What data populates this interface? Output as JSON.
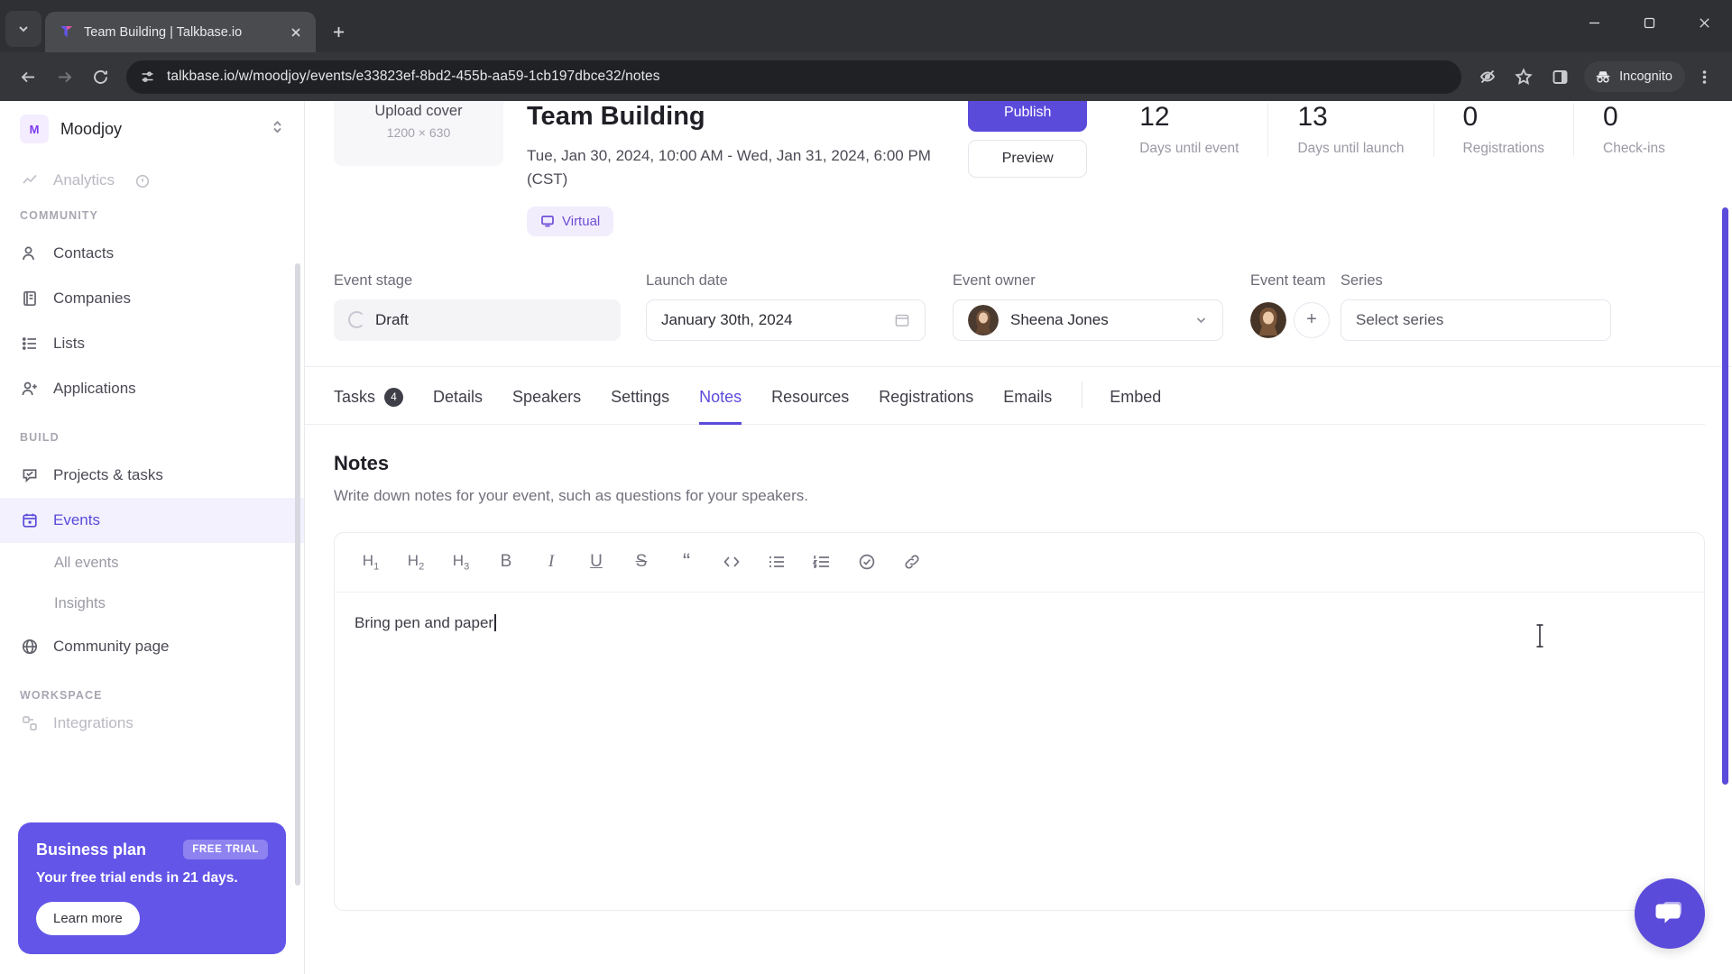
{
  "browser": {
    "tab": {
      "title": "Team Building | Talkbase.io",
      "favicon": "talkbase-logo-icon"
    },
    "new_tab_label": "+",
    "url": "talkbase.io/w/moodjoy/events/e33823ef-8bd2-455b-aa59-1cb197dbce32/notes",
    "profile_label": "Incognito",
    "icons": {
      "tab_search": "chevron-down-icon",
      "back": "back-arrow-icon",
      "forward": "forward-arrow-icon",
      "reload": "reload-icon",
      "site_info": "site-settings-icon",
      "tracking": "eye-off-icon",
      "bookmark": "star-icon",
      "side_panel": "side-panel-icon",
      "incognito": "incognito-icon",
      "menu": "three-dot-menu-icon",
      "minimize": "minimize-icon",
      "maximize": "maximize-icon",
      "close": "window-close-icon"
    }
  },
  "sidebar": {
    "workspace": {
      "badge": "M",
      "name": "Moodjoy",
      "chevron": "chevron-updown-icon"
    },
    "clipped_item": {
      "label": "Analytics",
      "icon": "analytics-icon",
      "info": "info-icon"
    },
    "sections": [
      {
        "label": "COMMUNITY",
        "items": [
          {
            "label": "Contacts",
            "icon": "contacts-icon"
          },
          {
            "label": "Companies",
            "icon": "companies-icon"
          },
          {
            "label": "Lists",
            "icon": "lists-icon"
          },
          {
            "label": "Applications",
            "icon": "applications-icon"
          }
        ]
      },
      {
        "label": "BUILD",
        "items": [
          {
            "label": "Projects & tasks",
            "icon": "tasks-icon"
          },
          {
            "label": "Events",
            "icon": "calendar-icon",
            "active": true
          },
          {
            "label": "All events",
            "sub": true
          },
          {
            "label": "Insights",
            "sub": true
          },
          {
            "label": "Community page",
            "icon": "globe-icon"
          }
        ]
      },
      {
        "label": "WORKSPACE",
        "items": [
          {
            "label": "Integrations",
            "icon": "integrations-icon",
            "clipped": true
          }
        ]
      }
    ],
    "promo": {
      "title": "Business plan",
      "badge": "FREE TRIAL",
      "subtitle": "Your free trial ends in 21 days.",
      "button": "Learn more"
    }
  },
  "event": {
    "cover": {
      "title": "Upload cover",
      "size": "1200 × 630"
    },
    "title": "Team Building",
    "date": "Tue, Jan 30, 2024, 10:00 AM - Wed, Jan 31, 2024, 6:00 PM (CST)",
    "format_chip": {
      "label": "Virtual",
      "icon": "screen-icon"
    },
    "actions": {
      "publish": "Publish",
      "preview": "Preview"
    },
    "stats": [
      {
        "value": "12",
        "label": "Days until event"
      },
      {
        "value": "13",
        "label": "Days until launch"
      },
      {
        "value": "0",
        "label": "Registrations"
      },
      {
        "value": "0",
        "label": "Check-ins"
      }
    ],
    "meta": {
      "stage": {
        "label": "Event stage",
        "value": "Draft",
        "icon": "spinner-icon"
      },
      "launch": {
        "label": "Launch date",
        "value": "January 30th, 2024",
        "icon": "calendar-small-icon"
      },
      "owner": {
        "label": "Event owner",
        "value": "Sheena Jones",
        "icon": "chevron-down-icon"
      },
      "team": {
        "label": "Event team",
        "add": "+"
      },
      "series": {
        "label": "Series",
        "value": "Select series"
      }
    }
  },
  "tabs": [
    {
      "label": "Tasks",
      "count": "4"
    },
    {
      "label": "Details"
    },
    {
      "label": "Speakers"
    },
    {
      "label": "Settings"
    },
    {
      "label": "Notes",
      "active": true
    },
    {
      "label": "Resources"
    },
    {
      "label": "Registrations"
    },
    {
      "label": "Emails"
    },
    {
      "label": "Embed",
      "separated": true
    }
  ],
  "notes": {
    "heading": "Notes",
    "description": "Write down notes for your event, such as questions for your speakers.",
    "toolbar": [
      {
        "name": "heading-1-button",
        "glyph": "H1"
      },
      {
        "name": "heading-2-button",
        "glyph": "H2"
      },
      {
        "name": "heading-3-button",
        "glyph": "H3"
      },
      {
        "name": "bold-button",
        "glyph": "B"
      },
      {
        "name": "italic-button",
        "glyph": "I"
      },
      {
        "name": "underline-button",
        "glyph": "U"
      },
      {
        "name": "strikethrough-button",
        "glyph": "S"
      },
      {
        "name": "blockquote-button",
        "glyph": "“"
      },
      {
        "name": "code-button",
        "glyph": "<>"
      },
      {
        "name": "bullet-list-button",
        "glyph": "list"
      },
      {
        "name": "ordered-list-button",
        "glyph": "olist"
      },
      {
        "name": "checklist-button",
        "glyph": "check"
      },
      {
        "name": "link-button",
        "glyph": "link"
      }
    ],
    "content": "Bring pen and paper"
  },
  "chat_widget": {
    "icon": "chat-bubble-icon"
  },
  "colors": {
    "accent": "#5b4bdb",
    "accent_soft": "#f2f1fd",
    "chrome_dark": "#2f3033",
    "toolbar_dark": "#35363a",
    "omnibox_dark": "#202124"
  }
}
